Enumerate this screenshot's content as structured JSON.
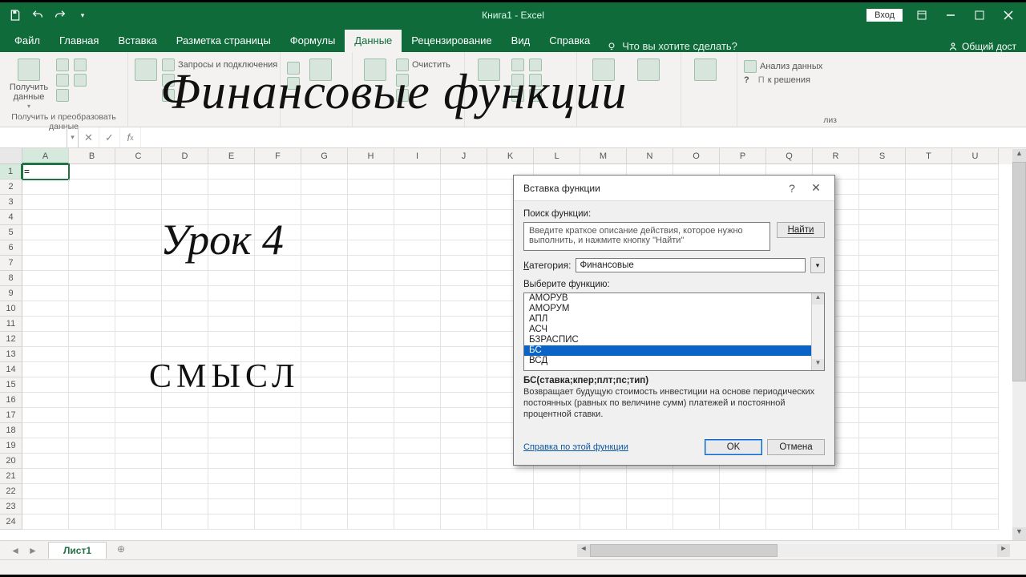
{
  "qat": {
    "title": "Книга1 - Excel",
    "login": "Вход"
  },
  "tabs": {
    "items": [
      "Файл",
      "Главная",
      "Вставка",
      "Разметка страницы",
      "Формулы",
      "Данные",
      "Рецензирование",
      "Вид",
      "Справка"
    ],
    "active_index": 5,
    "tell_me": "Что вы хотите сделать?",
    "share": "Общий дост"
  },
  "ribbon": {
    "g1": {
      "btn": "Получить данные",
      "label": "Получить и преобразовать данные"
    },
    "g2": {
      "side": "Запросы и подключения"
    },
    "g3": {
      "clear": "Очистить"
    },
    "g4": {
      "analysis": "Анализ данных",
      "solver_suffix": "к решения",
      "group_label": "лиз"
    }
  },
  "formula_bar": {
    "name_box": "",
    "value": ""
  },
  "grid": {
    "cols": [
      "A",
      "B",
      "C",
      "D",
      "E",
      "F",
      "G",
      "H",
      "I",
      "J",
      "K",
      "L",
      "M",
      "N",
      "O",
      "P",
      "Q",
      "R",
      "S",
      "T",
      "U"
    ],
    "rows": 24,
    "a1": "="
  },
  "overlay": {
    "t1": "Финансовые функции",
    "t2": "Урок 4",
    "t3": "СМЫСЛ"
  },
  "dialog": {
    "title": "Вставка функции",
    "search_label": "Поиск функции:",
    "search_placeholder": "Введите краткое описание действия, которое нужно выполнить, и нажмите кнопку \"Найти\"",
    "find": "Найти",
    "category_label": "Категория:",
    "category_value": "Финансовые",
    "select_label": "Выберите функцию:",
    "items": [
      "АМОРУВ",
      "АМОРУМ",
      "АПЛ",
      "АСЧ",
      "БЗРАСПИС",
      "БС",
      "ВСД"
    ],
    "selected_index": 5,
    "signature": "БС(ставка;кпер;плт;пс;тип)",
    "description": "Возвращает будущую стоимость инвестиции на основе периодических постоянных (равных по величине сумм) платежей и постоянной процентной ставки.",
    "help_link": "Справка по этой функции",
    "ok": "OK",
    "cancel": "Отмена"
  },
  "sheet": {
    "name": "Лист1"
  }
}
